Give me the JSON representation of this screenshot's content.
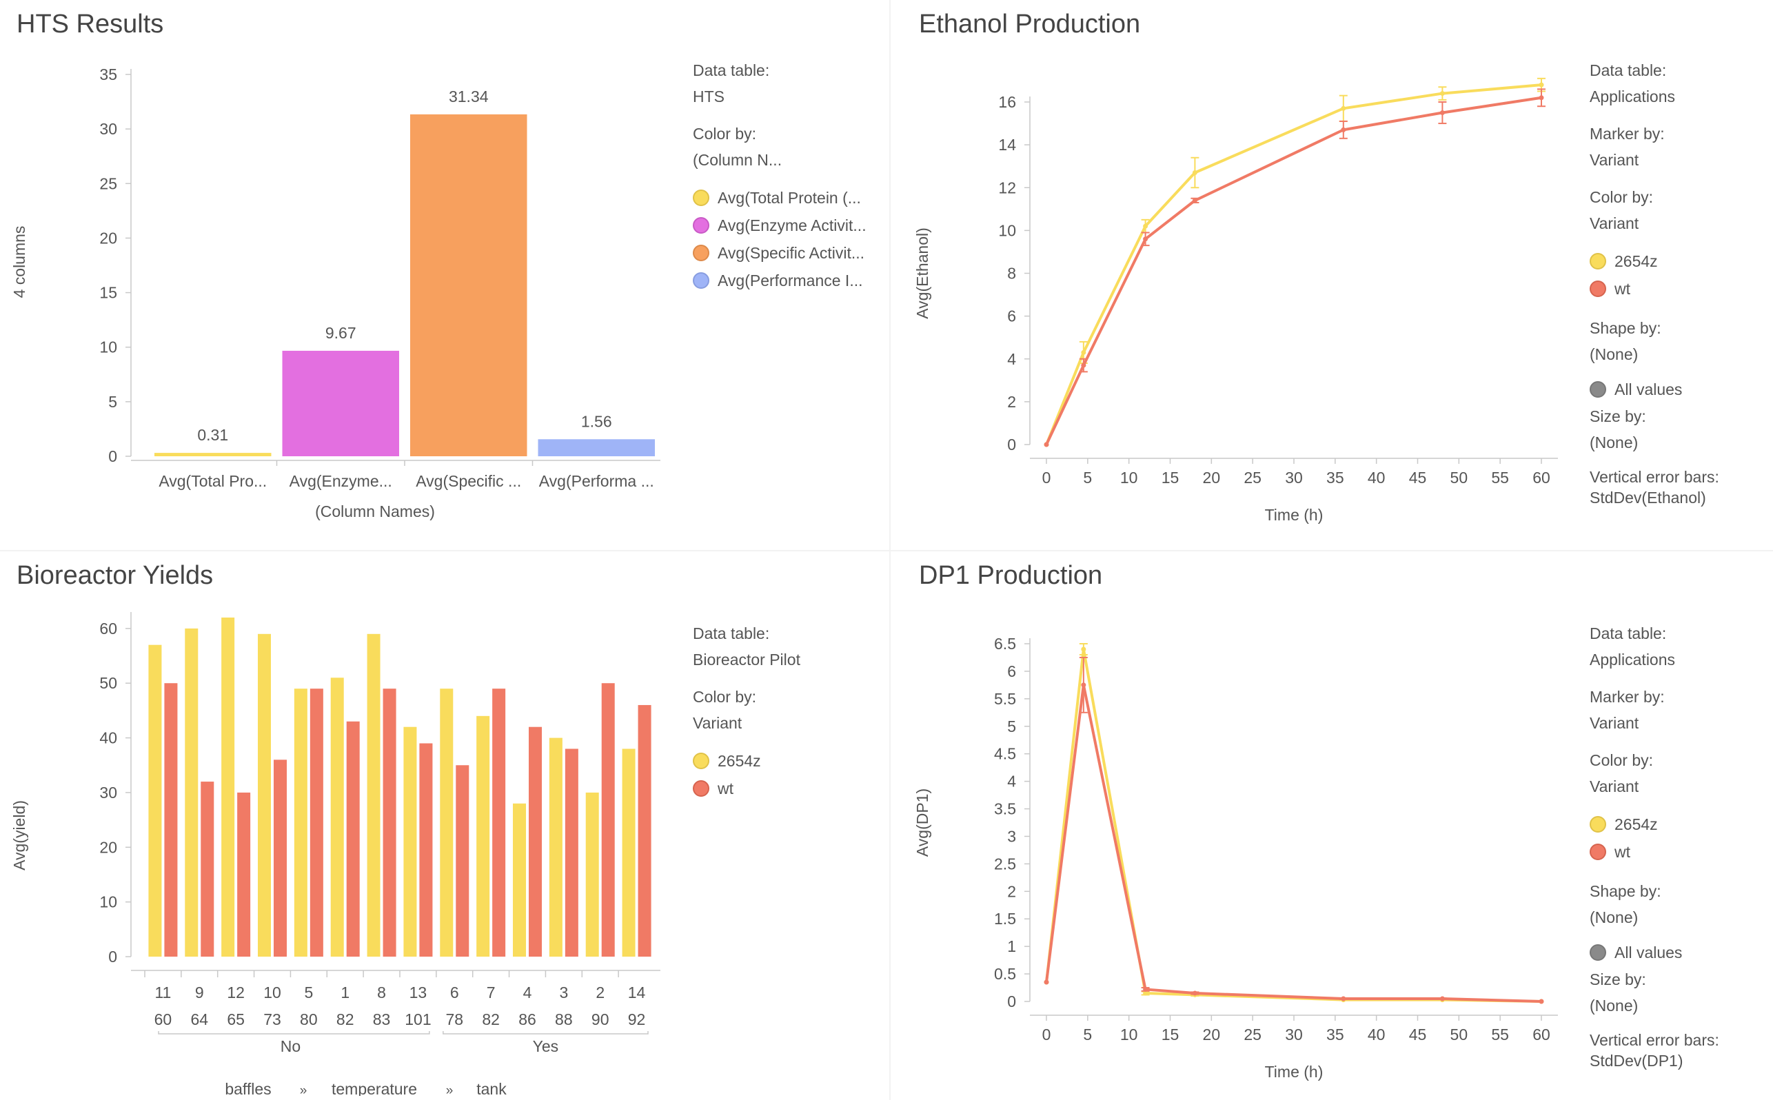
{
  "panels": {
    "hts": {
      "title": "HTS Results",
      "legend": {
        "data_table_label": "Data table:",
        "data_table": "HTS",
        "color_by_label": "Color by:",
        "color_by": "(Column N...",
        "items": [
          {
            "label": "Avg(Total Protein (...",
            "color": "#f9dc5c"
          },
          {
            "label": "Avg(Enzyme Activit...",
            "color": "#e36fe0"
          },
          {
            "label": "Avg(Specific Activit...",
            "color": "#f7a05e"
          },
          {
            "label": "Avg(Performance I...",
            "color": "#9fb4f7"
          }
        ]
      }
    },
    "ethanol": {
      "title": "Ethanol Production",
      "legend": {
        "data_table_label": "Data table:",
        "data_table": "Applications",
        "marker_by_label": "Marker by:",
        "marker_by": "Variant",
        "color_by_label": "Color by:",
        "color_by": "Variant",
        "items": [
          {
            "label": "2654z",
            "color": "#f9dc5c"
          },
          {
            "label": "wt",
            "color": "#f07a65"
          }
        ],
        "shape_by_label": "Shape by:",
        "shape_by": "(None)",
        "shape_item": "All values",
        "size_by_label": "Size by:",
        "size_by": "(None)",
        "error_label": "Vertical error bars:",
        "error_value": "StdDev(Ethanol)"
      }
    },
    "bioreactor": {
      "title": "Bioreactor Yields",
      "legend": {
        "data_table_label": "Data table:",
        "data_table": "Bioreactor Pilot",
        "color_by_label": "Color by:",
        "color_by": "Variant",
        "items": [
          {
            "label": "2654z",
            "color": "#f9dc5c"
          },
          {
            "label": "wt",
            "color": "#f07a65"
          }
        ]
      }
    },
    "dp1": {
      "title": "DP1 Production",
      "legend": {
        "data_table_label": "Data table:",
        "data_table": "Applications",
        "marker_by_label": "Marker by:",
        "marker_by": "Variant",
        "color_by_label": "Color by:",
        "color_by": "Variant",
        "items": [
          {
            "label": "2654z",
            "color": "#f9dc5c"
          },
          {
            "label": "wt",
            "color": "#f07a65"
          }
        ],
        "shape_by_label": "Shape by:",
        "shape_by": "(None)",
        "shape_item": "All values",
        "size_by_label": "Size by:",
        "size_by": "(None)",
        "error_label": "Vertical error bars:",
        "error_value": "StdDev(DP1)"
      }
    }
  },
  "chart_data": [
    {
      "id": "hts",
      "type": "bar",
      "title": "HTS Results",
      "xlabel": "(Column Names)",
      "ylabel": "4 columns",
      "categories": [
        "Avg(Total Pro...",
        "Avg(Enzyme...",
        "Avg(Specific ...",
        "Avg(Performa ..."
      ],
      "values": [
        0.31,
        9.67,
        31.34,
        1.56
      ],
      "data_labels": [
        "0.31",
        "9.67",
        "31.34",
        "1.56"
      ],
      "colors": [
        "#f9dc5c",
        "#e36fe0",
        "#f7a05e",
        "#9fb4f7"
      ],
      "ylim": [
        0,
        35
      ],
      "yticks": [
        0,
        5,
        10,
        15,
        20,
        25,
        30,
        35
      ]
    },
    {
      "id": "ethanol",
      "type": "line",
      "title": "Ethanol Production",
      "xlabel": "Time (h)",
      "ylabel": "Avg(Ethanol)",
      "xlim": [
        0,
        60
      ],
      "ylim": [
        0,
        16
      ],
      "xticks": [
        0,
        5,
        10,
        15,
        20,
        25,
        30,
        35,
        40,
        45,
        50,
        55,
        60
      ],
      "yticks": [
        0,
        2,
        4,
        6,
        8,
        10,
        12,
        14,
        16
      ],
      "series": [
        {
          "name": "2654z",
          "color": "#f9dc5c",
          "x": [
            0,
            4.5,
            12,
            18,
            36,
            48,
            60
          ],
          "y": [
            0,
            4.3,
            10.2,
            12.7,
            15.7,
            16.4,
            16.8
          ],
          "err": [
            0,
            0.5,
            0.3,
            0.7,
            0.6,
            0.3,
            0.3
          ]
        },
        {
          "name": "wt",
          "color": "#f07a65",
          "x": [
            0,
            4.5,
            12,
            18,
            36,
            48,
            60
          ],
          "y": [
            0,
            3.7,
            9.6,
            11.4,
            14.7,
            15.5,
            16.2
          ],
          "err": [
            0,
            0.3,
            0.3,
            0.1,
            0.4,
            0.5,
            0.4
          ]
        }
      ]
    },
    {
      "id": "bioreactor",
      "type": "bar",
      "title": "Bioreactor Yields",
      "ylabel": "Avg(yield)",
      "ylim": [
        0,
        62
      ],
      "yticks": [
        0,
        10,
        20,
        30,
        40,
        50,
        60
      ],
      "categories": [
        {
          "tank": "11",
          "temperature": "60",
          "baffles": "No"
        },
        {
          "tank": "9",
          "temperature": "64",
          "baffles": "No"
        },
        {
          "tank": "12",
          "temperature": "65",
          "baffles": "No"
        },
        {
          "tank": "10",
          "temperature": "73",
          "baffles": "No"
        },
        {
          "tank": "5",
          "temperature": "80",
          "baffles": "No"
        },
        {
          "tank": "1",
          "temperature": "82",
          "baffles": "No"
        },
        {
          "tank": "8",
          "temperature": "83",
          "baffles": "No"
        },
        {
          "tank": "13",
          "temperature": "101",
          "baffles": "No"
        },
        {
          "tank": "6",
          "temperature": "78",
          "baffles": "Yes"
        },
        {
          "tank": "7",
          "temperature": "82",
          "baffles": "Yes"
        },
        {
          "tank": "4",
          "temperature": "86",
          "baffles": "Yes"
        },
        {
          "tank": "3",
          "temperature": "88",
          "baffles": "Yes"
        },
        {
          "tank": "2",
          "temperature": "90",
          "baffles": "Yes"
        },
        {
          "tank": "14",
          "temperature": "92",
          "baffles": "Yes"
        }
      ],
      "groups": [
        "No",
        "Yes"
      ],
      "hierarchy_labels": [
        "baffles",
        "temperature",
        "tank"
      ],
      "hierarchy_separator": "»",
      "series": [
        {
          "name": "2654z",
          "color": "#f9dc5c",
          "values": [
            57,
            60,
            62,
            59,
            49,
            51,
            59,
            42,
            49,
            44,
            28,
            40,
            30,
            38
          ]
        },
        {
          "name": "wt",
          "color": "#f07a65",
          "values": [
            50,
            32,
            30,
            36,
            49,
            43,
            49,
            39,
            35,
            49,
            42,
            38,
            50,
            46
          ]
        }
      ]
    },
    {
      "id": "dp1",
      "type": "line",
      "title": "DP1 Production",
      "xlabel": "Time (h)",
      "ylabel": "Avg(DP1)",
      "xlim": [
        0,
        60
      ],
      "ylim": [
        0,
        6.5
      ],
      "xticks": [
        0,
        5,
        10,
        15,
        20,
        25,
        30,
        35,
        40,
        45,
        50,
        55,
        60
      ],
      "yticks": [
        0,
        0.5,
        1,
        1.5,
        2,
        2.5,
        3,
        3.5,
        4,
        4.5,
        5,
        5.5,
        6,
        6.5
      ],
      "series": [
        {
          "name": "2654z",
          "color": "#f9dc5c",
          "x": [
            0,
            4.5,
            12,
            18,
            36,
            48,
            60
          ],
          "y": [
            0.35,
            6.4,
            0.15,
            0.12,
            0.03,
            0.03,
            0.0
          ],
          "err": [
            0,
            0.1,
            0.03,
            0.02,
            0.01,
            0.01,
            0
          ]
        },
        {
          "name": "wt",
          "color": "#f07a65",
          "x": [
            0,
            4.5,
            12,
            18,
            36,
            48,
            60
          ],
          "y": [
            0.35,
            5.75,
            0.22,
            0.15,
            0.05,
            0.05,
            0.0
          ],
          "err": [
            0,
            0.5,
            0.03,
            0.02,
            0.01,
            0.01,
            0
          ]
        }
      ]
    }
  ]
}
